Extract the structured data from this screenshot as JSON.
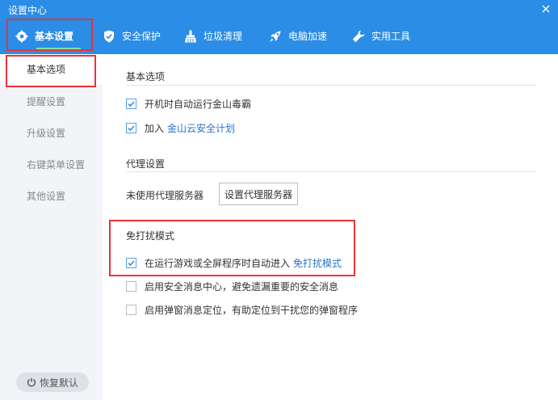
{
  "window": {
    "title": "设置中心",
    "close_icon": "close-icon"
  },
  "tabs": [
    {
      "label": "基本设置",
      "icon": "gear-icon",
      "active": true
    },
    {
      "label": "安全保护",
      "icon": "shield-icon"
    },
    {
      "label": "垃圾清理",
      "icon": "broom-icon"
    },
    {
      "label": "电脑加速",
      "icon": "rocket-icon"
    },
    {
      "label": "实用工具",
      "icon": "wrench-icon"
    }
  ],
  "sidebar": {
    "items": [
      {
        "label": "基本选项",
        "active": true
      },
      {
        "label": "提醒设置"
      },
      {
        "label": "升级设置"
      },
      {
        "label": "右键菜单设置"
      },
      {
        "label": "其他设置"
      }
    ],
    "restore_label": "恢复默认"
  },
  "basic": {
    "title": "基本选项",
    "autorun": {
      "label": "开机时自动运行金山毒霸",
      "checked": true
    },
    "cloud": {
      "label": "加入",
      "link": "金山云安全计划",
      "checked": true
    }
  },
  "proxy": {
    "title": "代理设置",
    "status": "未使用代理服务器",
    "button": "设置代理服务器"
  },
  "dnd": {
    "title": "免打扰模式",
    "option1": {
      "label": "在运行游戏或全屏程序时自动进入",
      "link": "免打扰模式",
      "checked": true
    },
    "option2": {
      "label": "启用安全消息中心，避免遗漏重要的安全消息",
      "checked": false
    },
    "option3": {
      "label": "启用弹窗消息定位，有助定位到干扰您的弹窗程序",
      "checked": false
    }
  },
  "colors": {
    "header": "#2b8de6",
    "accent_underline": "#7fe49a",
    "link": "#2475c9",
    "highlight": "#e8333a"
  }
}
